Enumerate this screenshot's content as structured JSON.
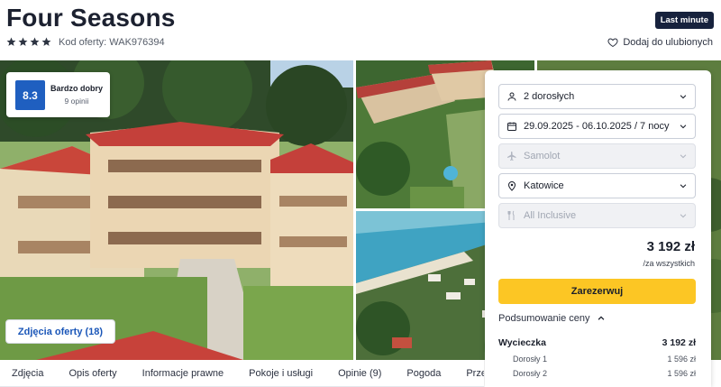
{
  "header": {
    "title": "Four Seasons",
    "stars": 4,
    "offer_code": "Kod oferty: WAK976394",
    "badge": "Last minute",
    "favorite_label": "Dodaj do ulubionych"
  },
  "rating": {
    "score": "8.3",
    "label": "Bardzo dobry",
    "count": "9 opinii"
  },
  "gallery": {
    "photos_button": "Zdjęcia oferty (18)"
  },
  "booking": {
    "guests": "2 dorosłych",
    "dates": "29.09.2025 - 06.10.2025 / 7 nocy",
    "transport": "Samolot",
    "departure": "Katowice",
    "board": "All Inclusive",
    "price": "3 192 zł",
    "price_note": "/za wszystkich",
    "book_button": "Zarezerwuj",
    "summary_label": "Podsumowanie ceny",
    "summary": {
      "main_label": "Wycieczka",
      "main_value": "3 192 zł",
      "items": [
        {
          "label": "Dorosły 1",
          "value": "1 596 zł"
        },
        {
          "label": "Dorosły 2",
          "value": "1 596 zł"
        }
      ]
    }
  },
  "tabs": [
    "Zdjęcia",
    "Opis oferty",
    "Informacje prawne",
    "Pokoje i usługi",
    "Opinie (9)",
    "Pogoda",
    "Przed"
  ],
  "colors": {
    "brand_blue": "#1f5fc0",
    "accent_yellow": "#fcc624",
    "badge_navy": "#17223d",
    "link_blue": "#1a56b8"
  }
}
